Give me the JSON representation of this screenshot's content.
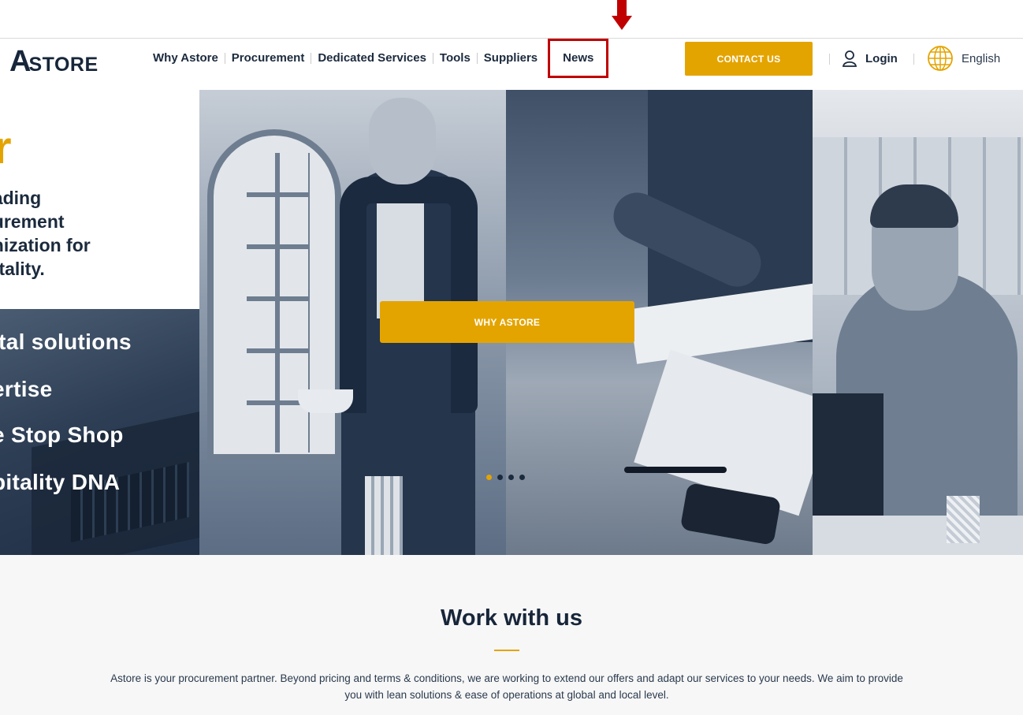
{
  "brand": {
    "logo_letter": "A",
    "logo_rest": "STORE"
  },
  "nav": {
    "items": [
      "Why Astore",
      "Procurement",
      "Dedicated Services",
      "Tools",
      "Suppliers",
      "News"
    ],
    "contact_label": "CONTACT US",
    "login_label": "Login",
    "language_label": "English"
  },
  "hero": {
    "accent_text": "r",
    "tagline": "eading\ncurement\nanization for\npitality.",
    "benefits": [
      "ital solutions",
      "ertise",
      "e Stop Shop",
      "pitality DNA"
    ],
    "cta_label": "WHY ASTORE",
    "slides_total": 4,
    "slide_active": 1
  },
  "work": {
    "title": "Work with us",
    "description": "Astore is your procurement partner. Beyond pricing and terms & conditions, we are working to extend our offers and adapt our services to your needs. We aim to provide you with lean solutions & ease of operations at global and local level."
  },
  "colors": {
    "accent": "#e4a400",
    "navy": "#17263a",
    "annotation": "#c00000"
  }
}
